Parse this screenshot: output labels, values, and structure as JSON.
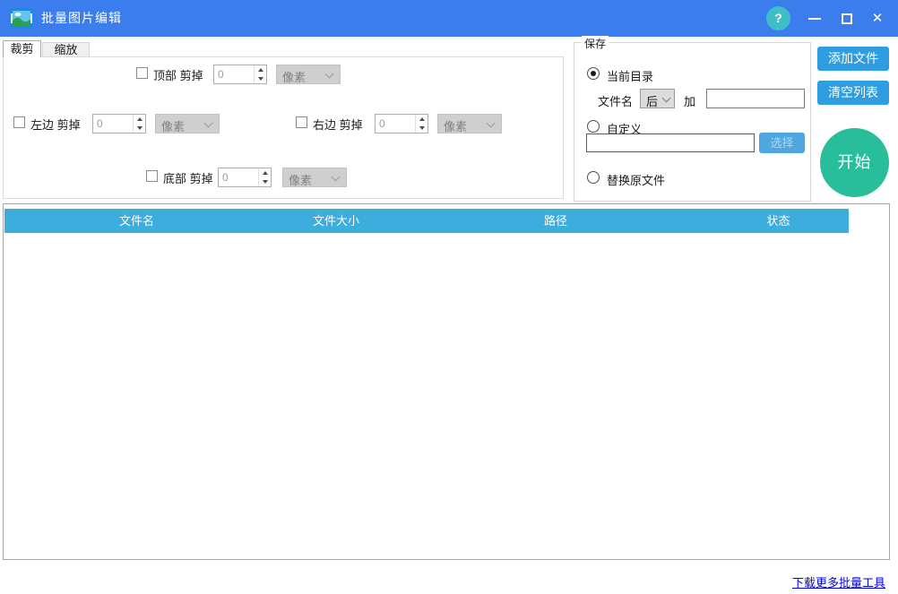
{
  "titlebar": {
    "title": "批量图片编辑",
    "help_glyph": "?",
    "close_glyph": "✕"
  },
  "tabs": [
    {
      "label": "裁剪",
      "active": true
    },
    {
      "label": "缩放",
      "active": false
    }
  ],
  "crop": {
    "top": {
      "label": "顶部 剪掉",
      "value": "0",
      "unit": "像素",
      "checked": false
    },
    "left": {
      "label": "左边 剪掉",
      "value": "0",
      "unit": "像素",
      "checked": false
    },
    "right": {
      "label": "右边 剪掉",
      "value": "0",
      "unit": "像素",
      "checked": false
    },
    "bottom": {
      "label": "底部 剪掉",
      "value": "0",
      "unit": "像素",
      "checked": false
    }
  },
  "save": {
    "group_label": "保存",
    "current_dir": {
      "label": "当前目录",
      "selected": true
    },
    "filename_label": "文件名",
    "position_value": "后",
    "add_label": "加",
    "suffix_value": "",
    "custom": {
      "label": "自定义",
      "selected": false,
      "path_value": "",
      "choose_label": "选择"
    },
    "replace": {
      "label": "替换原文件",
      "selected": false
    }
  },
  "actions": {
    "add_files": "添加文件",
    "clear_list": "清空列表",
    "start": "开始"
  },
  "table": {
    "columns": [
      "文件名",
      "文件大小",
      "路径",
      "状态"
    ],
    "rows": []
  },
  "footer": {
    "link": "下载更多批量工具"
  },
  "colors": {
    "titlebar": "#3b7dec",
    "help_circle": "#3fbec8",
    "table_header": "#3daddd",
    "action_button": "#2f9de2",
    "start_button": "#28bd9b",
    "link": "#0000ee"
  }
}
